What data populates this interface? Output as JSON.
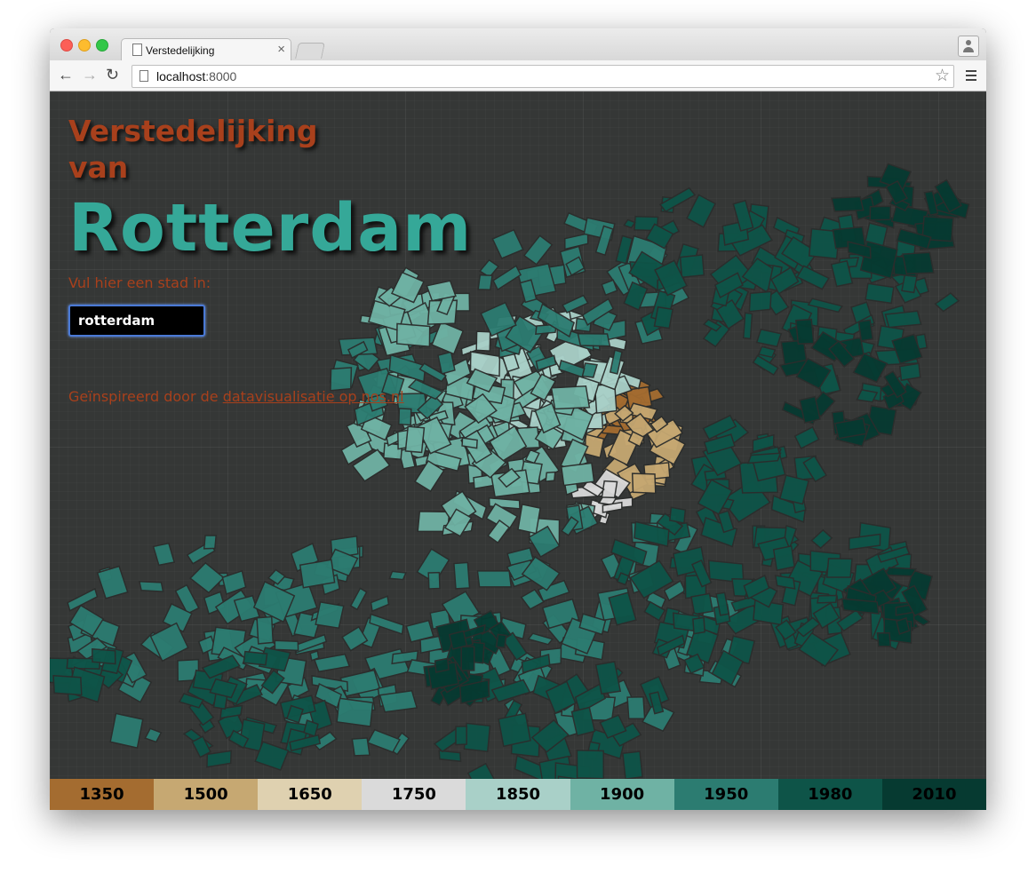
{
  "browser": {
    "tab_title": "Verstedelijking",
    "tab_close": "×",
    "url_host": "localhost",
    "url_port": ":8000",
    "back": "←",
    "forward": "→",
    "reload": "↻",
    "star": "☆"
  },
  "page": {
    "title_line1": "Verstedelijking",
    "title_line2": "van",
    "city_title": "Rotterdam",
    "prompt": "Vul hier een stad in:",
    "city_input_value": "rotterdam",
    "credit_prefix": "Geïnspireerd door de ",
    "credit_link": "datavisualisatie op nos.nl"
  },
  "legend": [
    {
      "label": "1350",
      "color": "#a46c30"
    },
    {
      "label": "1500",
      "color": "#c6a872"
    },
    {
      "label": "1650",
      "color": "#dfd1b0"
    },
    {
      "label": "1750",
      "color": "#dadada"
    },
    {
      "label": "1850",
      "color": "#a9d0c8"
    },
    {
      "label": "1900",
      "color": "#6fb2a4"
    },
    {
      "label": "1950",
      "color": "#2c7c71"
    },
    {
      "label": "1980",
      "color": "#0e5448"
    },
    {
      "label": "2010",
      "color": "#063a31"
    }
  ],
  "colors": {
    "accent_orange": "#a8401c",
    "accent_teal": "#35a898",
    "background": "#353736"
  }
}
